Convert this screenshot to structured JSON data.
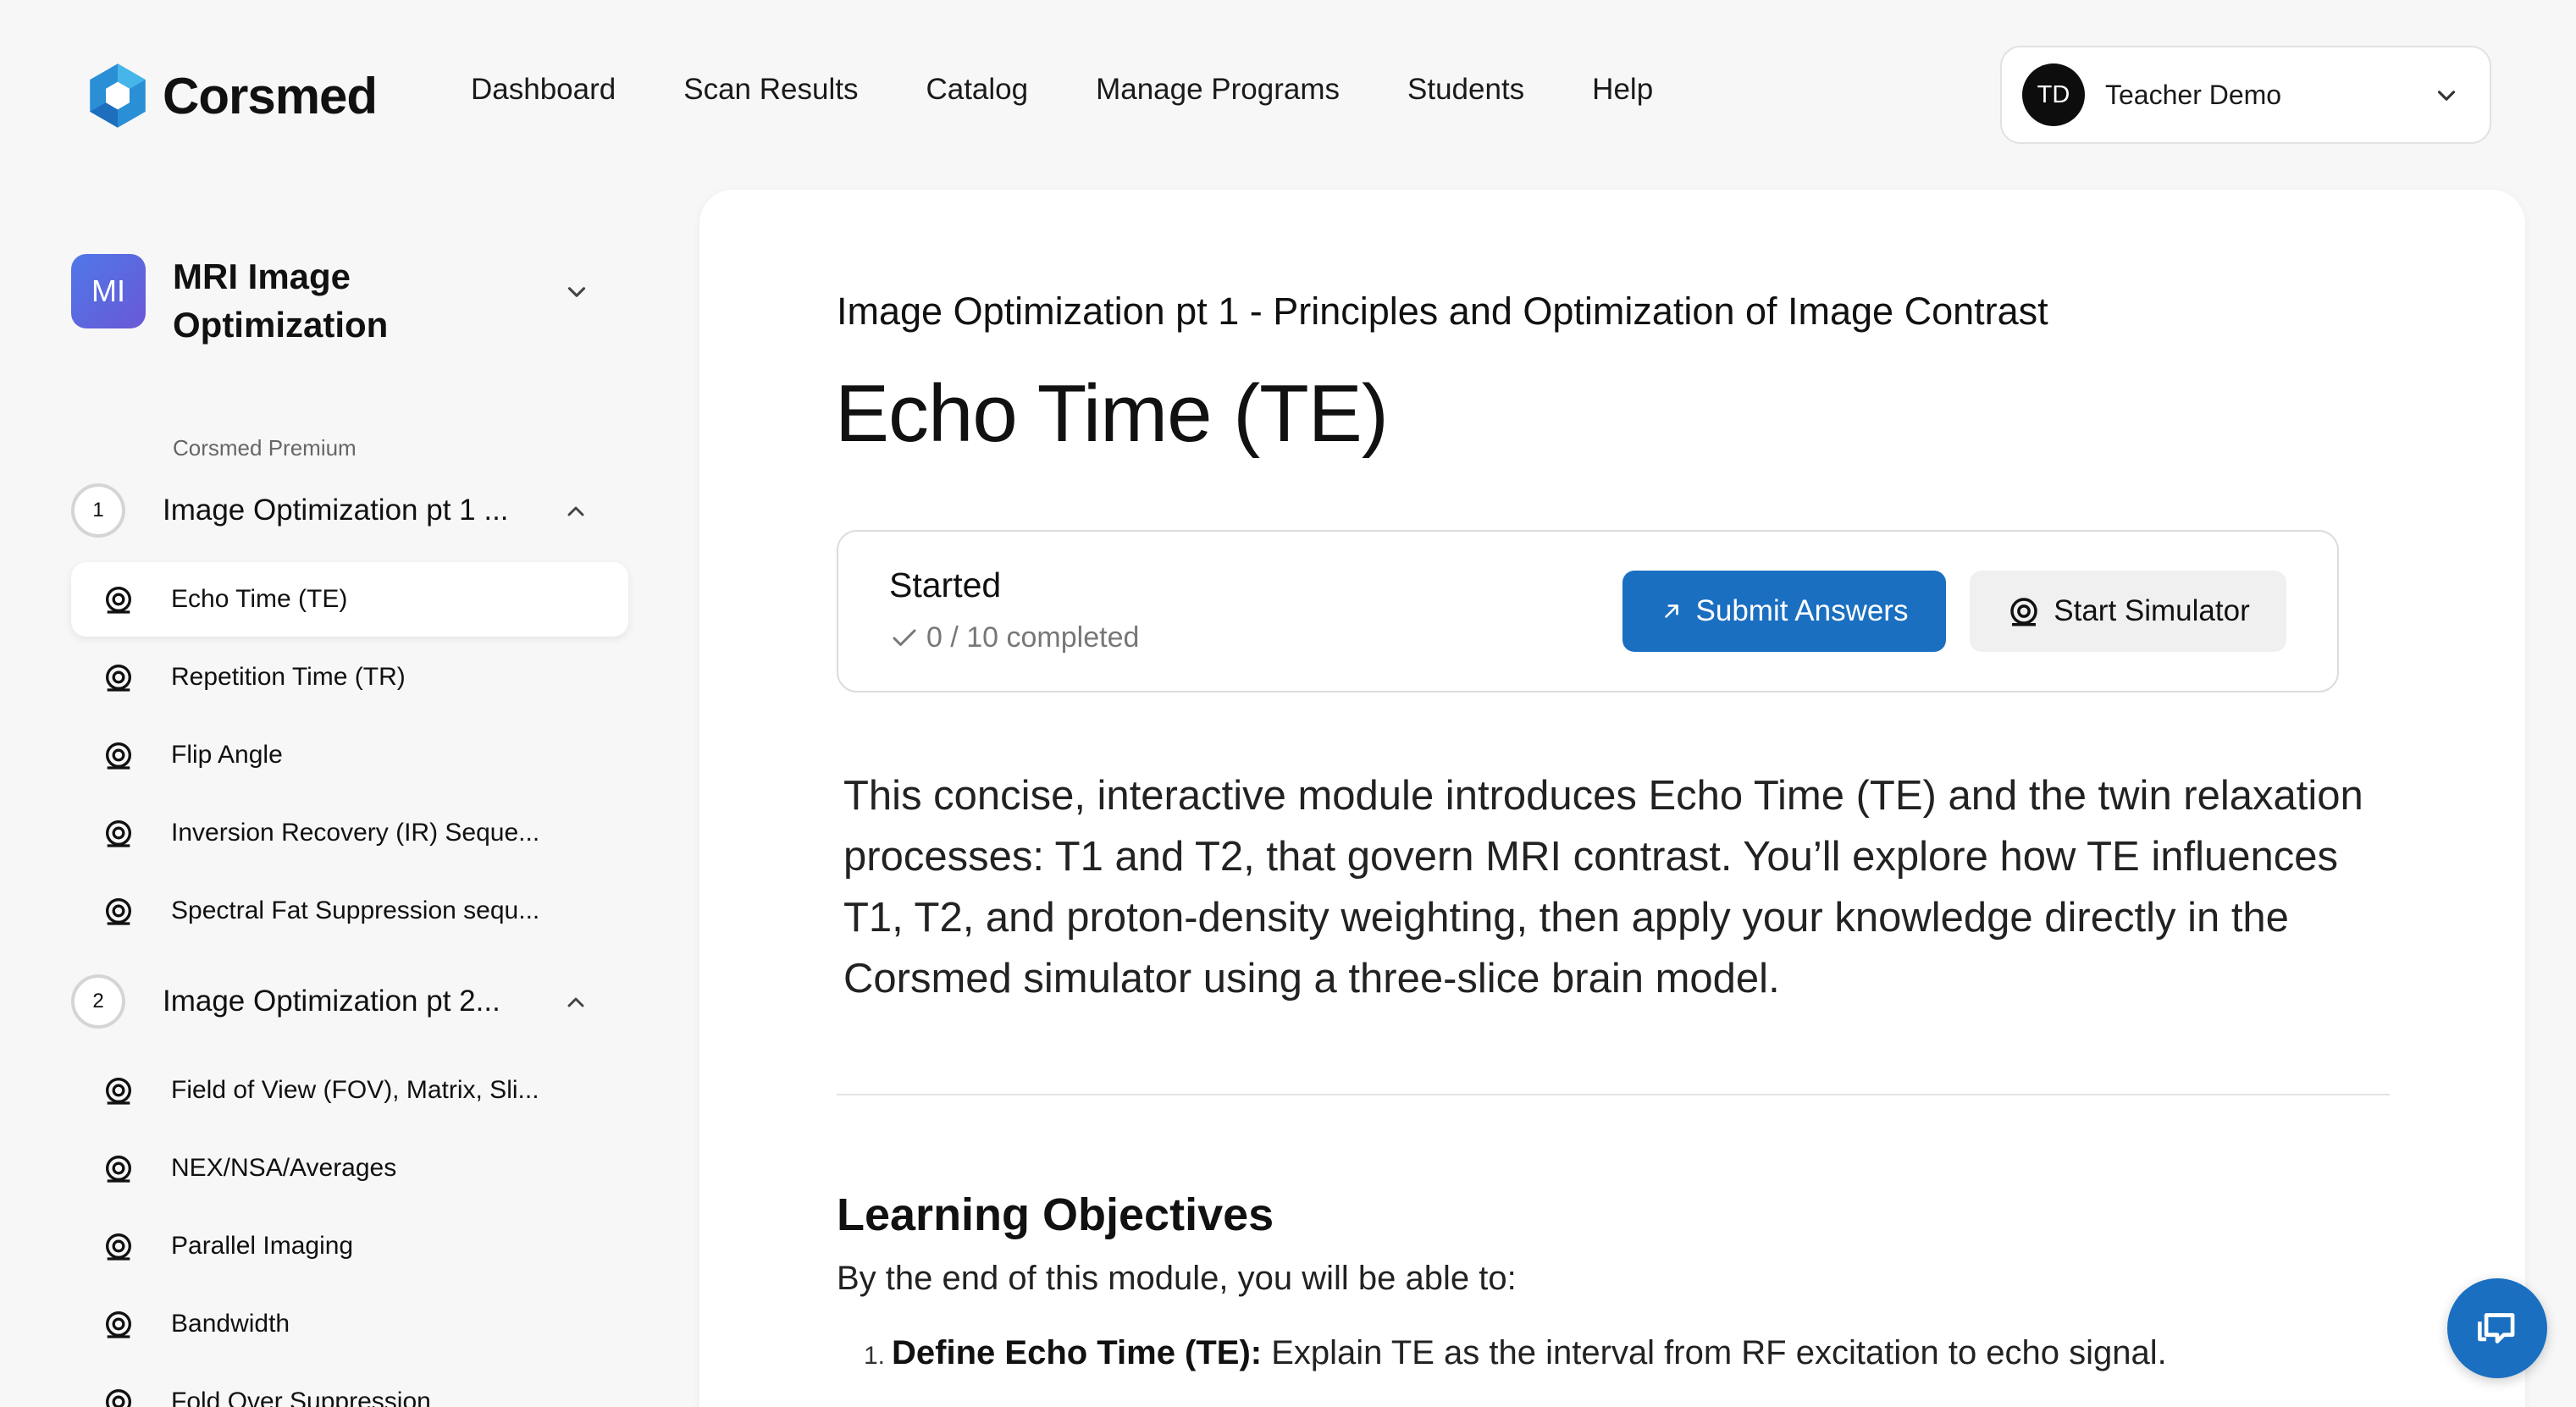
{
  "app": {
    "logo_text": "Corsmed",
    "accent_color": "#1a6fc0"
  },
  "nav": {
    "items": [
      "Dashboard",
      "Scan Results",
      "Catalog",
      "Manage Programs",
      "Students",
      "Help"
    ]
  },
  "user": {
    "initials": "TD",
    "name": "Teacher Demo"
  },
  "sidebar": {
    "program": {
      "badge": "MI",
      "title": "MRI Image Optimization",
      "subtitle": "Corsmed Premium"
    },
    "sections": [
      {
        "number": "1",
        "label": "Image Optimization pt 1 ...",
        "lessons": [
          "Echo Time (TE)",
          "Repetition Time (TR)",
          "Flip Angle",
          "Inversion Recovery (IR) Seque...",
          "Spectral Fat Suppression sequ..."
        ]
      },
      {
        "number": "2",
        "label": "Image Optimization pt 2...",
        "lessons": [
          "Field of View (FOV), Matrix, Sli...",
          "NEX/NSA/Averages",
          "Parallel Imaging",
          "Bandwidth",
          "Fold Over Suppression"
        ]
      }
    ],
    "active_lesson": "Echo Time (TE)"
  },
  "main": {
    "breadcrumb": "Image Optimization pt 1 - Principles and Optimization of Image Contrast",
    "title": "Echo Time (TE)",
    "status": {
      "label": "Started",
      "progress": "0 / 10 completed",
      "submit_label": "Submit Answers",
      "simulator_label": "Start Simulator"
    },
    "intro": "This concise, interactive module introduces Echo Time (TE) and the twin relaxation processes: T1 and T2, that govern MRI contrast. You’ll explore how TE influences T1, T2, and proton-density weighting, then apply your knowledge directly in the Corsmed simulator using a three-slice brain model.",
    "objectives": {
      "heading": "Learning Objectives",
      "intro": "By the end of this module, you will be able to:",
      "items": [
        {
          "number": "1.",
          "term": "Define Echo Time (TE):",
          "text": " Explain TE as the interval from RF excitation to echo signal."
        }
      ]
    }
  }
}
